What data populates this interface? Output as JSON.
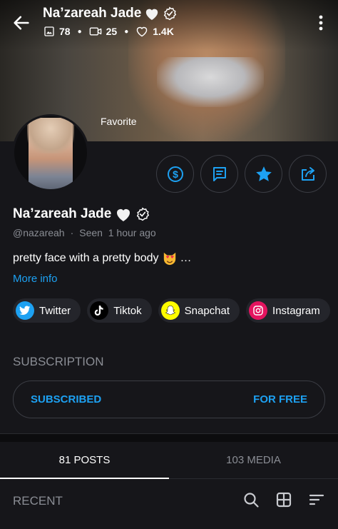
{
  "header": {
    "name": "Na’zareah Jade",
    "photos": "78",
    "videos": "25",
    "likes": "1.4K"
  },
  "cover": {
    "badge_label": "Favorite"
  },
  "profile": {
    "name": "Na’zareah Jade",
    "username": "@nazareah",
    "separator": "·",
    "last_seen": "Seen  1 hour ago",
    "bio": "pretty face with a pretty body",
    "bio_ellipsis": "…",
    "more_info": "More info"
  },
  "actions": [
    {
      "icon": "dollar-tip-icon"
    },
    {
      "icon": "message-icon"
    },
    {
      "icon": "star-icon"
    },
    {
      "icon": "share-icon"
    }
  ],
  "socials": [
    {
      "label": "Twitter",
      "color": "#1da1f2"
    },
    {
      "label": "Tiktok",
      "color": "#000000"
    },
    {
      "label": "Snapchat",
      "color": "#fffc00"
    },
    {
      "label": "Instagram",
      "color": "#e4145f"
    }
  ],
  "subscription": {
    "title": "SUBSCRIPTION",
    "status": "SUBSCRIBED",
    "price": "FOR FREE"
  },
  "tabs": [
    {
      "label": "81 POSTS",
      "active": true
    },
    {
      "label": "103 MEDIA",
      "active": false
    }
  ],
  "feed": {
    "section_label": "RECENT"
  },
  "colors": {
    "accent": "#1da1f2",
    "background": "#16161a",
    "muted": "#8a8d94"
  }
}
